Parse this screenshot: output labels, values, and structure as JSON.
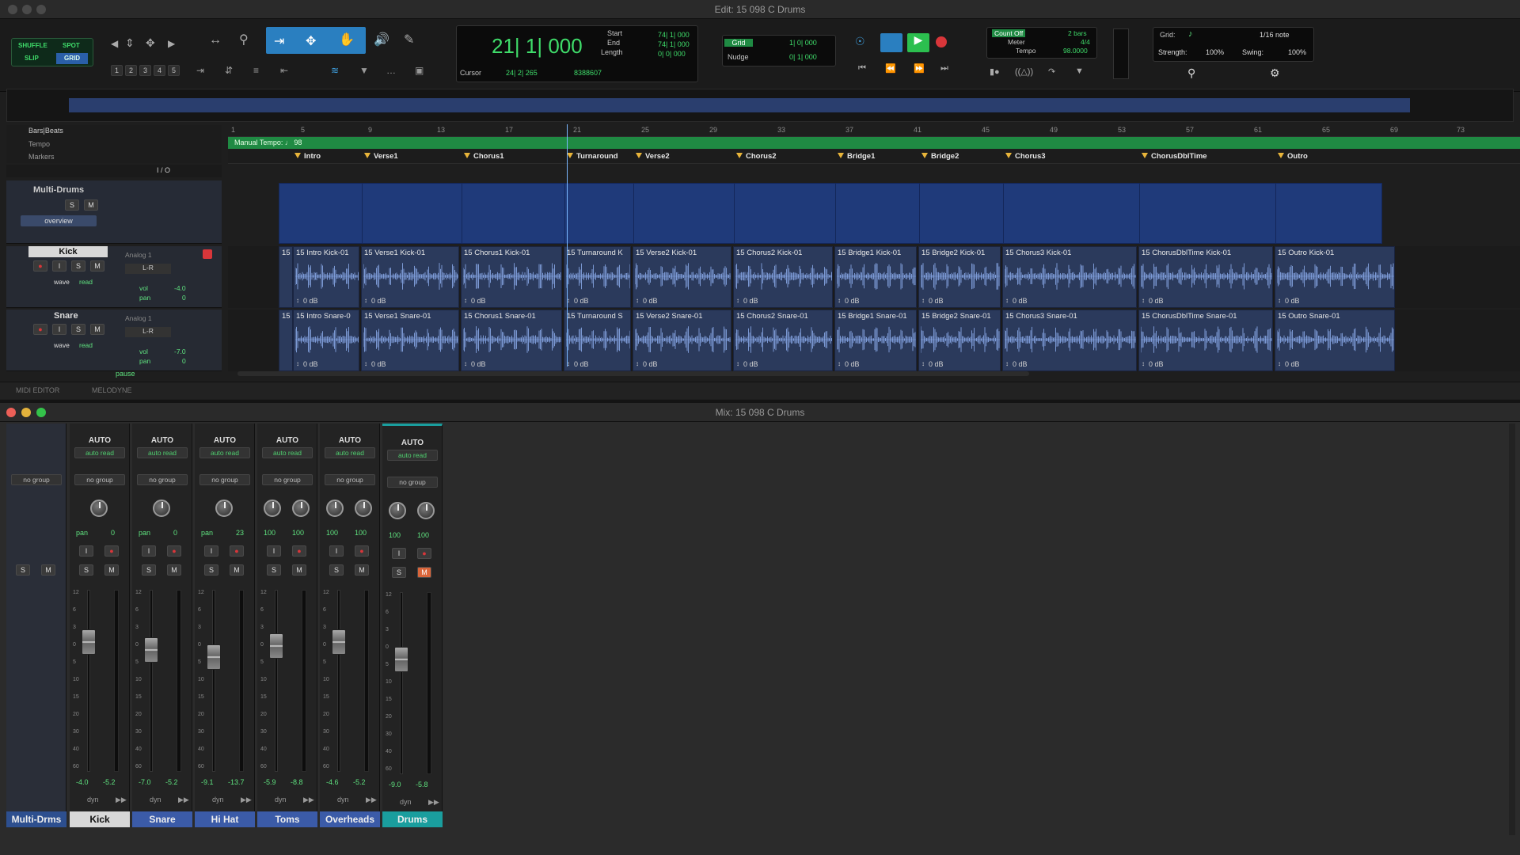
{
  "edit_window": {
    "title": "Edit: 15 098 C Drums",
    "modes": {
      "shuffle": "SHUFFLE",
      "spot": "SPOT",
      "slip": "SLIP",
      "grid": "GRID"
    },
    "zoom_presets": [
      "1",
      "2",
      "3",
      "4",
      "5"
    ],
    "counter": {
      "main": "21| 1| 000",
      "start_label": "Start",
      "start": "74| 1| 000",
      "end_label": "End",
      "end": "74| 1| 000",
      "length_label": "Length",
      "length": "0| 0| 000",
      "cursor_label": "Cursor",
      "cursor": "24| 2| 265",
      "cursor_sample": "8388607"
    },
    "grid": {
      "label": "Grid",
      "value": "1| 0| 000"
    },
    "nudge": {
      "label": "Nudge",
      "value": "0| 1| 000"
    },
    "count_off": {
      "label": "Count Off",
      "bars": "2 bars",
      "meter_label": "Meter",
      "meter": "4/4",
      "tempo_label": "Tempo",
      "tempo": "98.0000"
    },
    "grid_settings": {
      "grid_label": "Grid:",
      "grid_value": "1/16 note",
      "strength_label": "Strength:",
      "strength": "100%",
      "swing_label": "Swing:",
      "swing": "100%"
    },
    "rulers": {
      "bars_beats": "Bars|Beats",
      "tempo": "Tempo",
      "markers": "Markers"
    },
    "bar_numbers": [
      "1",
      "5",
      "9",
      "13",
      "17",
      "21",
      "25",
      "29",
      "33",
      "37",
      "41",
      "45",
      "49",
      "53",
      "57",
      "61",
      "65",
      "69",
      "73"
    ],
    "manual_tempo": "Manual Tempo: ♩ 98",
    "markers": [
      "Intro",
      "Verse1",
      "Chorus1",
      "Turnaround",
      "Verse2",
      "Chorus2",
      "Bridge1",
      "Bridge2",
      "Chorus3",
      "ChorusDblTime",
      "Outro"
    ],
    "io_label": "I / O",
    "tracks": {
      "folder": {
        "name": "Multi-Drums",
        "overview": "overview"
      },
      "kick": {
        "name": "Kick",
        "input": "Analog 1",
        "output": "L-R",
        "view": "wave",
        "mode": "read",
        "vol_label": "vol",
        "vol": "-4.0",
        "pan_label": "pan",
        "pan": "0"
      },
      "snare": {
        "name": "Snare",
        "input": "Analog 1",
        "output": "L-R",
        "view": "wave",
        "mode": "read",
        "vol_label": "vol",
        "vol": "-7.0",
        "pan_label": "pan",
        "pan": "0"
      }
    },
    "kick_clips": [
      "15 Intro Kick-01",
      "15 Verse1 Kick-01",
      "15 Chorus1 Kick-01",
      "15 Turnaround K",
      "15 Verse2 Kick-01",
      "15 Chorus2 Kick-01",
      "15 Bridge1 Kick-01",
      "15 Bridge2 Kick-01",
      "15 Chorus3 Kick-01",
      "15 ChorusDblTime Kick-01",
      "15 Outro Kick-01"
    ],
    "snare_clips": [
      "15 Intro Snare-0",
      "15 Verse1 Snare-01",
      "15 Chorus1 Snare-01",
      "15 Turnaround S",
      "15 Verse2 Snare-01",
      "15 Chorus2 Snare-01",
      "15 Bridge1 Snare-01",
      "15 Bridge2 Snare-01",
      "15 Chorus3 Snare-01",
      "15 ChorusDblTime Snare-01",
      "15 Outro Snare-01"
    ],
    "clip_prefix": "15",
    "clip_gain": "0 dB",
    "status": "pause",
    "bottom_tabs": [
      "MIDI EDITOR",
      "MELODYNE"
    ]
  },
  "mix_window": {
    "title": "Mix: 15 098 C Drums",
    "folder_strip": {
      "name": "Multi-Drms",
      "group": "no group",
      "solo": "S",
      "mute": "M"
    },
    "auto_label": "AUTO",
    "auto_mode": "auto read",
    "group": "no group",
    "channels": [
      {
        "name": "Kick",
        "pan_label": "pan",
        "pan": "0",
        "vol": "-4.0",
        "peak": "-5.2",
        "dyn": "dyn",
        "knobs": 1,
        "fader": 0.72
      },
      {
        "name": "Snare",
        "pan_label": "pan",
        "pan": "0",
        "vol": "-7.0",
        "peak": "-5.2",
        "dyn": "dyn",
        "knobs": 1,
        "fader": 0.68
      },
      {
        "name": "Hi Hat",
        "pan_label": "pan",
        "pan": "23",
        "vol": "-9.1",
        "peak": "-13.7",
        "dyn": "dyn",
        "knobs": 1,
        "fader": 0.64
      },
      {
        "name": "Toms",
        "pan_l": "100",
        "pan_r": "100",
        "vol": "-5.9",
        "peak": "-8.8",
        "dyn": "dyn",
        "knobs": 2,
        "fader": 0.7
      },
      {
        "name": "Overheads",
        "pan_l": "100",
        "pan_r": "100",
        "vol": "-4.6",
        "peak": "-5.2",
        "dyn": "dyn",
        "knobs": 2,
        "fader": 0.72
      },
      {
        "name": "Drums",
        "pan_l": "100",
        "pan_r": "100",
        "vol": "-9.0",
        "peak": "-5.8",
        "dyn": "dyn",
        "knobs": 2,
        "fader": 0.64
      }
    ],
    "meter_scale": [
      "12",
      "6",
      "3",
      "0",
      "5",
      "10",
      "15",
      "20",
      "30",
      "40",
      "60"
    ],
    "colors": {
      "channel_name_bg": "#3b5ba8",
      "drums_accent": "#1a9e9e",
      "mute_active": "#d9653a",
      "tempo_ruler": "#1f8a43"
    }
  }
}
